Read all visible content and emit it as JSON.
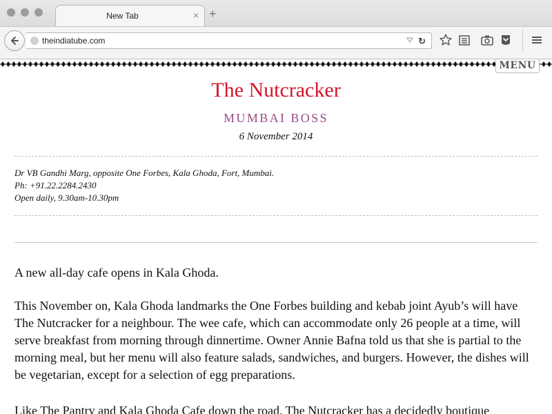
{
  "browser": {
    "tab_title": "New Tab",
    "tab_close_glyph": "×",
    "new_tab_glyph": "+",
    "url": "theindiatube.com",
    "reload_glyph": "↻"
  },
  "site": {
    "menu_label": "MENU"
  },
  "article": {
    "title": "The Nutcracker",
    "section": "MUMBAI BOSS",
    "date": "6 November 2014",
    "address": "Dr VB Gandhi Marg, opposite One Forbes, Kala Ghoda, Fort, Mumbai.",
    "phone": "Ph: +91.22.2284.2430",
    "hours": "Open daily, 9.30am-10.30pm",
    "paragraphs": [
      "A new all-day cafe opens in Kala Ghoda.",
      "This November on, Kala Ghoda landmarks the One Forbes building and kebab joint Ayub’s will have The Nutcracker for a neighbour. The wee cafe, which can accommodate only 26 people at a time, will serve breakfast from morning through dinnertime. Owner Annie Bafna told us that she is partial to the morning meal, but her menu will also feature salads, sandwiches, and burgers. However, the dishes will be vegetarian, except for a selection of egg preparations.",
      "Like The Pantry and Kala Ghoda Cafe down the road, The Nutcracker has a decidedly boutique"
    ]
  },
  "colors": {
    "title": "#d4142a",
    "section": "#9a4a86"
  }
}
